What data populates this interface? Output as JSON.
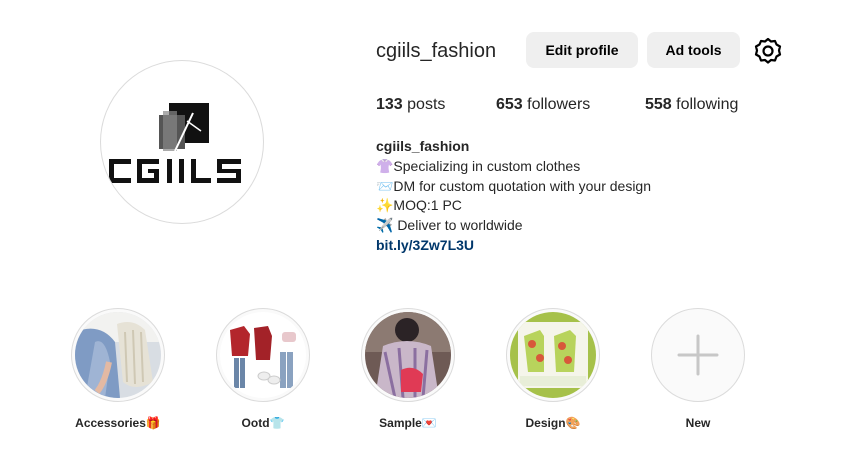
{
  "profile": {
    "username": "cgiils_fashion",
    "avatar_text": "CGIILS",
    "edit_profile_label": "Edit profile",
    "ad_tools_label": "Ad tools",
    "settings_icon": "gear-icon"
  },
  "stats": {
    "posts_count": "133",
    "posts_label": " posts",
    "followers_count": "653",
    "followers_label": " followers",
    "following_count": "558",
    "following_label": " following"
  },
  "bio": {
    "name": "cgiils_fashion",
    "lines": [
      "👚Specializing in custom clothes",
      "📨DM for custom quotation with your design",
      "✨MOQ:1 PC",
      "✈️ Deliver to worldwide"
    ],
    "link": "bit.ly/3Zw7L3U"
  },
  "highlights": [
    {
      "label": "Accessories🎁"
    },
    {
      "label": "Ootd👕"
    },
    {
      "label": "Sample💌"
    },
    {
      "label": "Design🎨"
    },
    {
      "label": "New"
    }
  ],
  "colors": {
    "button_bg": "#efefef",
    "link": "#00376b",
    "border": "#dbdbdb",
    "text": "#262626"
  }
}
